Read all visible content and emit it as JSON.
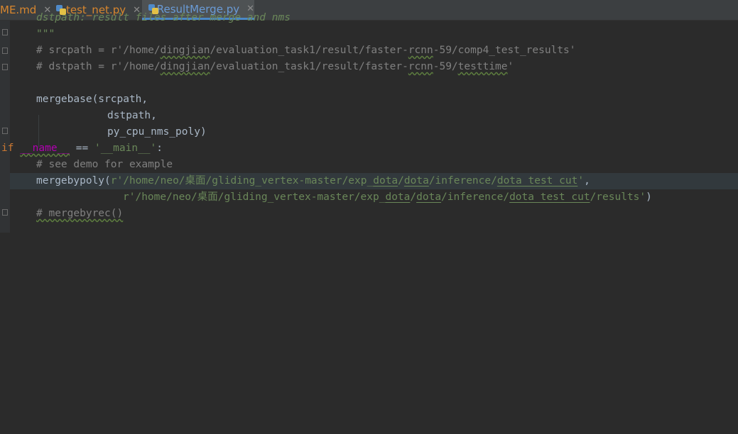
{
  "tabs": [
    {
      "label": "ME.md",
      "active": false
    },
    {
      "label": "test_net.py",
      "active": false
    },
    {
      "label": "ResultMerge.py",
      "active": true
    }
  ],
  "code": {
    "l0_partial": "dstpath: result files after merge and nms",
    "l1_doc_end": "\"\"\"",
    "l2_comment_pre": "# srcpath = r'/home/",
    "l2_comment_user": "dingjian",
    "l2_comment_mid": "/evaluation_task1/result/faster-",
    "l2_comment_rcnn": "rcnn",
    "l2_comment_post": "-59/comp4_test_results'",
    "l3_comment_pre": "# dstpath = r'/home/",
    "l3_comment_user": "dingjian",
    "l3_comment_mid": "/evaluation_task1/result/faster-",
    "l3_comment_rcnn": "rcnn",
    "l3_comment_mid2": "-59/",
    "l3_comment_testtime": "testtime",
    "l3_comment_post": "'",
    "l5_call": "mergebase(srcpath,",
    "l6_arg": "dstpath,",
    "l7_arg": "py_cpu_nms_poly)",
    "l8_if": "if",
    "l8_name": "__name__",
    "l8_eq": " == ",
    "l8_main": "'__main__'",
    "l8_colon": ":",
    "l9_comment": "# see demo for example",
    "l10_fn": "mergebypoly",
    "l10_paren": "(",
    "l10_str_pre": "r'/home/neo/桌面/gliding_vertex-master/exp_",
    "l10_str_dota1": "dota",
    "l10_slash": "/",
    "l10_str_dota2": "dota",
    "l10_str_mid": "/inference/",
    "l10_str_cut": "dota_test_cut",
    "l10_str_end": "'",
    "l10_comma": ",",
    "l11_str_pre": "r'/home/neo/桌面/gliding_vertex-master/exp_",
    "l11_str_dota1": "dota",
    "l11_slash": "/",
    "l11_str_dota2": "dota",
    "l11_str_mid": "/inference/",
    "l11_str_cut": "dota_test_cut",
    "l11_str_end": "/results'",
    "l11_close": ")",
    "l12_comment": "# mergebyrec()"
  }
}
